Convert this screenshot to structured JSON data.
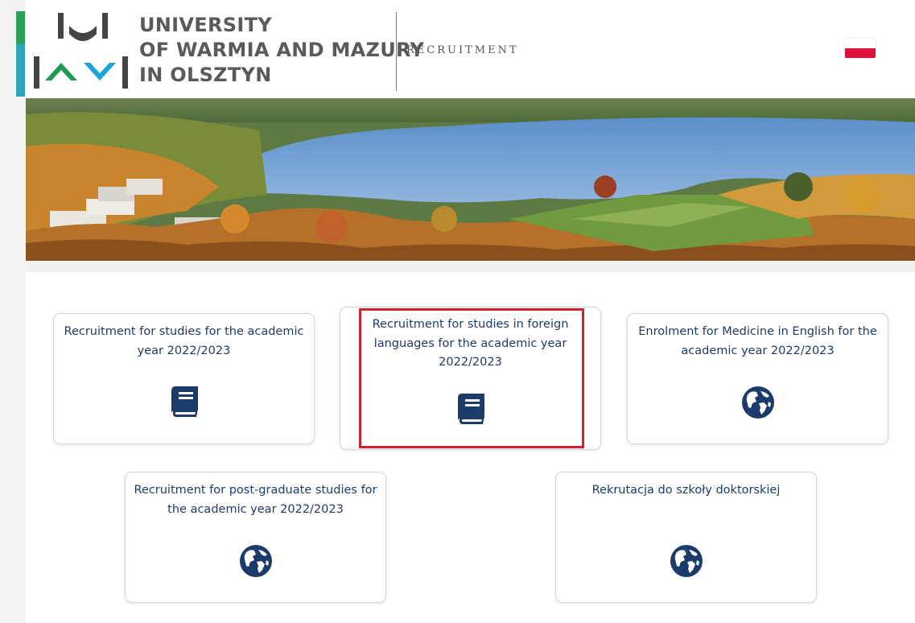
{
  "header": {
    "university_name_lines": [
      "UNIVERSITY",
      "OF WARMIA AND MAZURY",
      "IN OLSZTYN"
    ],
    "section_label": "RECRUITMENT",
    "language_flag": "Polish flag (switch language)",
    "accent_colors": {
      "green": "#2e9e5b",
      "cyan": "#2aa6b7",
      "logo_blue": "#1aa3d9",
      "logo_dark": "#444444"
    }
  },
  "banner": {
    "alt": "Aerial view of campus by the lake in autumn"
  },
  "cards": [
    {
      "title": "Recruitment for studies for the academic year 2022/2023",
      "icon": "book-icon"
    },
    {
      "title": "Recruitment for studies in foreign languages for the academic year 2022/2023",
      "icon": "book-icon",
      "highlighted": true
    },
    {
      "title": "Enrolment for Medicine in English for the academic year 2022/2023",
      "icon": "globe-icon"
    },
    {
      "title": "Recruitment for post-graduate studies for the academic year 2022/2023",
      "icon": "globe-icon"
    },
    {
      "title": "Rekrutacja do szkoły doktorskiej",
      "icon": "globe-icon"
    }
  ],
  "colors": {
    "card_text": "#1e3b66",
    "icon": "#1b3c6b",
    "highlight": "#d2202f"
  }
}
